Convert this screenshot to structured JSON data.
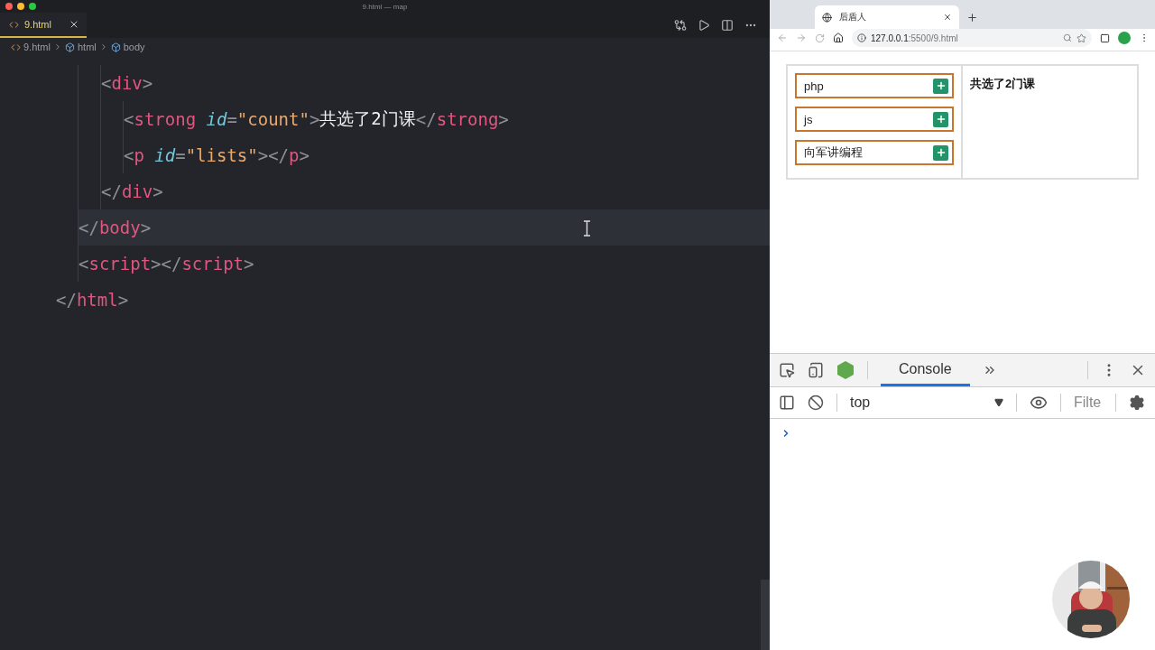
{
  "editor": {
    "window_title": "9.html — map",
    "tabs": [
      {
        "label": "9.html",
        "selected": true
      }
    ],
    "breadcrumbs": [
      "9.html",
      "html",
      "body"
    ],
    "code": [
      {
        "children": [
          {
            "children": [
              {
                "current": false,
                "tokens": [
                  {
                    "kind": "punct",
                    "text": "<"
                  },
                  {
                    "kind": "tag",
                    "text": "div"
                  },
                  {
                    "kind": "punct",
                    "text": ">"
                  }
                ]
              },
              {
                "children": [
                  {
                    "current": false,
                    "tokens": [
                      {
                        "kind": "punct",
                        "text": "<"
                      },
                      {
                        "kind": "tag",
                        "text": "strong"
                      },
                      {
                        "kind": "attr",
                        "text": "id"
                      },
                      {
                        "kind": "punct",
                        "text": "="
                      },
                      {
                        "kind": "string",
                        "text": "\"count\""
                      },
                      {
                        "kind": "punct",
                        "text": ">"
                      },
                      {
                        "kind": "text",
                        "text": "共选了2门课"
                      },
                      {
                        "kind": "punct",
                        "text": "</"
                      },
                      {
                        "kind": "tag",
                        "text": "strong"
                      },
                      {
                        "kind": "punct",
                        "text": ">"
                      }
                    ]
                  },
                  {
                    "current": false,
                    "tokens": [
                      {
                        "kind": "punct",
                        "text": "<"
                      },
                      {
                        "kind": "tag",
                        "text": "p"
                      },
                      {
                        "kind": "attr",
                        "text": "id"
                      },
                      {
                        "kind": "punct",
                        "text": "="
                      },
                      {
                        "kind": "string",
                        "text": "\"lists\""
                      },
                      {
                        "kind": "punct",
                        "text": "></"
                      },
                      {
                        "kind": "tag",
                        "text": "p"
                      },
                      {
                        "kind": "punct",
                        "text": ">"
                      }
                    ]
                  }
                ]
              },
              {
                "current": false,
                "tokens": [
                  {
                    "kind": "punct",
                    "text": "</"
                  },
                  {
                    "kind": "tag",
                    "text": "div"
                  },
                  {
                    "kind": "punct",
                    "text": ">"
                  }
                ]
              }
            ]
          },
          {
            "current": true,
            "tokens": [
              {
                "kind": "punct",
                "text": "</"
              },
              {
                "kind": "tag",
                "text": "body"
              },
              {
                "kind": "punct",
                "text": ">"
              }
            ]
          },
          {
            "current": false,
            "tokens": [
              {
                "kind": "punct",
                "text": "<"
              },
              {
                "kind": "tag",
                "text": "script"
              },
              {
                "kind": "punct",
                "text": "></"
              },
              {
                "kind": "tag",
                "text": "script"
              },
              {
                "kind": "punct",
                "text": ">"
              }
            ]
          }
        ]
      },
      {
        "current": false,
        "tokens": [
          {
            "kind": "punct",
            "text": "</"
          },
          {
            "kind": "tag",
            "text": "html"
          },
          {
            "kind": "punct",
            "text": ">"
          }
        ]
      }
    ]
  },
  "browser": {
    "tab_title": "后盾人",
    "url_host": "127.0.0.1",
    "url_path": ":5500/9.html",
    "page": {
      "courses": [
        {
          "name": "php"
        },
        {
          "name": "js"
        },
        {
          "name": "向军讲编程"
        }
      ],
      "count": "共选了2门课"
    }
  },
  "devtools": {
    "tabs": [
      {
        "label": "Console",
        "selected": true
      }
    ],
    "context": "top",
    "filter_placeholder": "Filte"
  }
}
